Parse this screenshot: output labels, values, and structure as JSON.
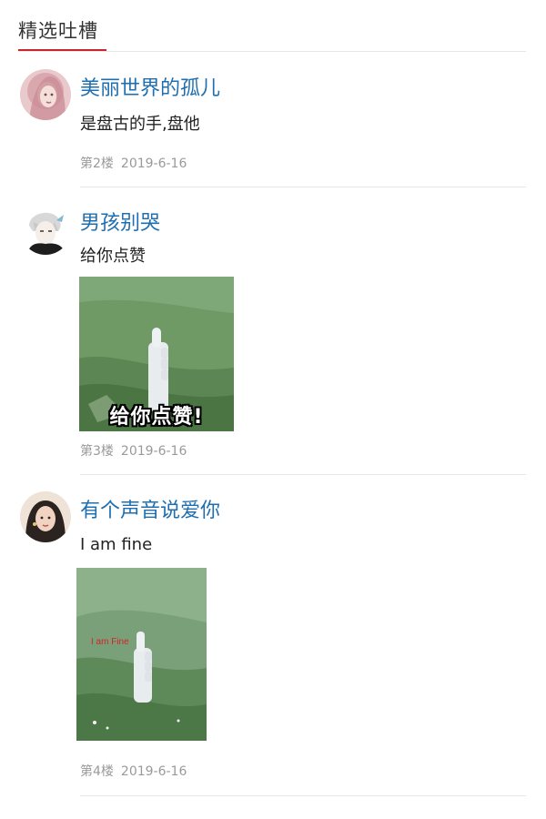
{
  "header": {
    "title": "精选吐槽",
    "accent_color": "#c9252c"
  },
  "comments": [
    {
      "user": "美丽世界的孤儿",
      "text": "是盘古的手,盘他",
      "floor": "第2楼",
      "date": "2019-6-16",
      "avatar_icon": "woman-avatar"
    },
    {
      "user": "男孩别哭",
      "text": "给你点赞",
      "floor": "第3楼",
      "date": "2019-6-16",
      "avatar_icon": "anime-boy-avatar",
      "image_caption": "给你点赞!"
    },
    {
      "user": "有个声音说爱你",
      "text": "I am fine",
      "floor": "第4楼",
      "date": "2019-6-16",
      "avatar_icon": "girl-avatar",
      "image_caption": "I am Fine"
    }
  ]
}
